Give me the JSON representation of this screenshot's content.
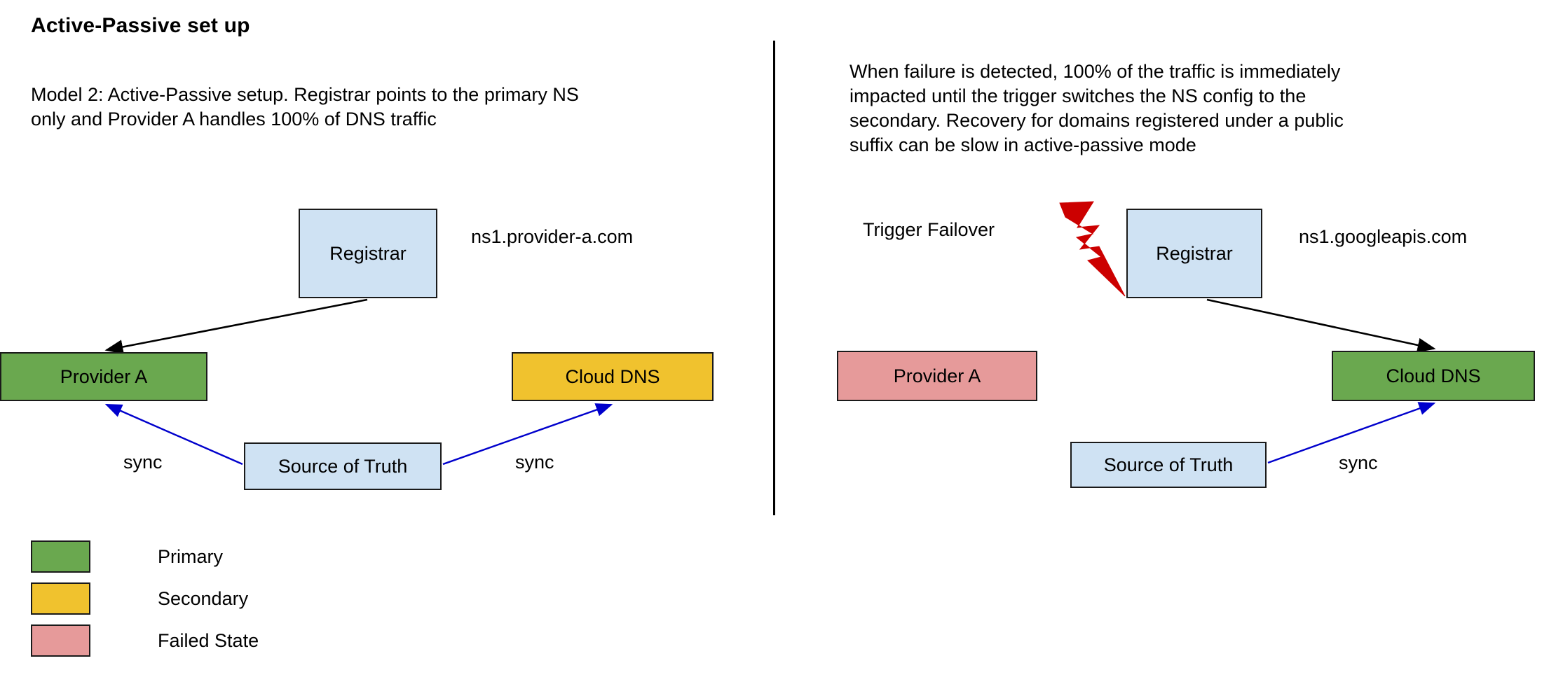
{
  "page": {
    "title": "Active-Passive set up"
  },
  "left_panel": {
    "description": "Model 2: Active-Passive setup. Registrar points to the primary NS\nonly and Provider A handles 100% of DNS traffic",
    "nodes": {
      "registrar": "Registrar",
      "provider_a": "Provider A",
      "cloud_dns": "Cloud DNS",
      "source_of_truth": "Source of Truth"
    },
    "labels": {
      "ns_record": "ns1.provider-a.com",
      "sync_left": "sync",
      "sync_right": "sync"
    }
  },
  "right_panel": {
    "description": "When failure is detected, 100% of the traffic is immediately\nimpacted until the trigger switches the NS config to the\nsecondary. Recovery for domains registered under a public\nsuffix can be slow in active-passive mode",
    "nodes": {
      "registrar": "Registrar",
      "provider_a": "Provider A",
      "cloud_dns": "Cloud DNS",
      "source_of_truth": "Source of Truth"
    },
    "labels": {
      "ns_record": "ns1.googleapis.com",
      "sync_right": "sync",
      "trigger_failover": "Trigger Failover"
    }
  },
  "legend": {
    "items": [
      {
        "label": "Primary",
        "color": "#6aa84f"
      },
      {
        "label": "Secondary",
        "color": "#f0c22e"
      },
      {
        "label": "Failed State",
        "color": "#e69a9a"
      }
    ]
  },
  "colors": {
    "primary_green": "#6aa84f",
    "secondary_yellow": "#f0c22e",
    "failed_red": "#e69a9a",
    "node_blue": "#cfe2f3",
    "sync_arrow_blue": "#0000cc",
    "ns_arrow_black": "#000000",
    "bolt_red": "#cc0000",
    "border_black": "#1a1a1a"
  }
}
